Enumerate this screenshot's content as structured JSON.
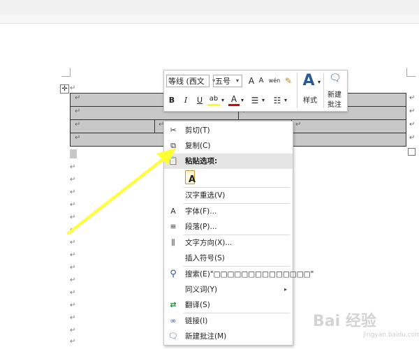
{
  "mini_toolbar": {
    "font_name": "等线 (西文",
    "font_size": "五号",
    "grow_font": "A",
    "shrink_font": "A",
    "phonetic": "wén",
    "bold": "B",
    "italic": "I",
    "underline": "U",
    "highlight": "ab",
    "font_color": "A",
    "styles_glyph": "A",
    "styles_label": "样式",
    "new_comment_label_1": "新建",
    "new_comment_label_2": "批注"
  },
  "paragraph_mark": "↵",
  "context_menu": {
    "items": [
      {
        "label": "剪切(T)",
        "icon": "scissors-icon",
        "glyph": "✂"
      },
      {
        "label": "复制(C)",
        "icon": "copy-icon",
        "glyph": "⧉"
      },
      {
        "label": "粘贴选项:",
        "icon": "paste-icon",
        "glyph": "📋"
      },
      {
        "label": "汉字重选(V)",
        "icon": "",
        "glyph": ""
      },
      {
        "label": "字体(F)...",
        "icon": "font-icon",
        "glyph": "A"
      },
      {
        "label": "段落(P)...",
        "icon": "paragraph-icon",
        "glyph": "≡"
      },
      {
        "label": "文字方向(X)...",
        "icon": "text-direction-icon",
        "glyph": "⫼"
      },
      {
        "label": "插入符号(S)",
        "icon": "",
        "glyph": ""
      },
      {
        "label": "搜索(E)\"□□□□□□□□□□□□□□\"",
        "icon": "search-icon",
        "glyph": "⚲"
      },
      {
        "label": "同义词(Y)",
        "icon": "",
        "glyph": ""
      },
      {
        "label": "翻译(S)",
        "icon": "translate-icon",
        "glyph": "⇄"
      },
      {
        "label": "链接(I)",
        "icon": "link-icon",
        "glyph": "∞"
      },
      {
        "label": "新建批注(M)",
        "icon": "comment-icon",
        "glyph": "🗨"
      }
    ],
    "paste_keep_text_glyph": "A",
    "submenu_arrow": "▸"
  },
  "watermark": "Bai 经验",
  "watermark_sub": "jingyan.baidu.com",
  "colors": {
    "table_fill": "#c8c8c8",
    "highlight_color": "#ffff00",
    "font_color_bar": "#e00000",
    "arrow": "#ffff33",
    "menu_hover": "#e5e5e5"
  }
}
